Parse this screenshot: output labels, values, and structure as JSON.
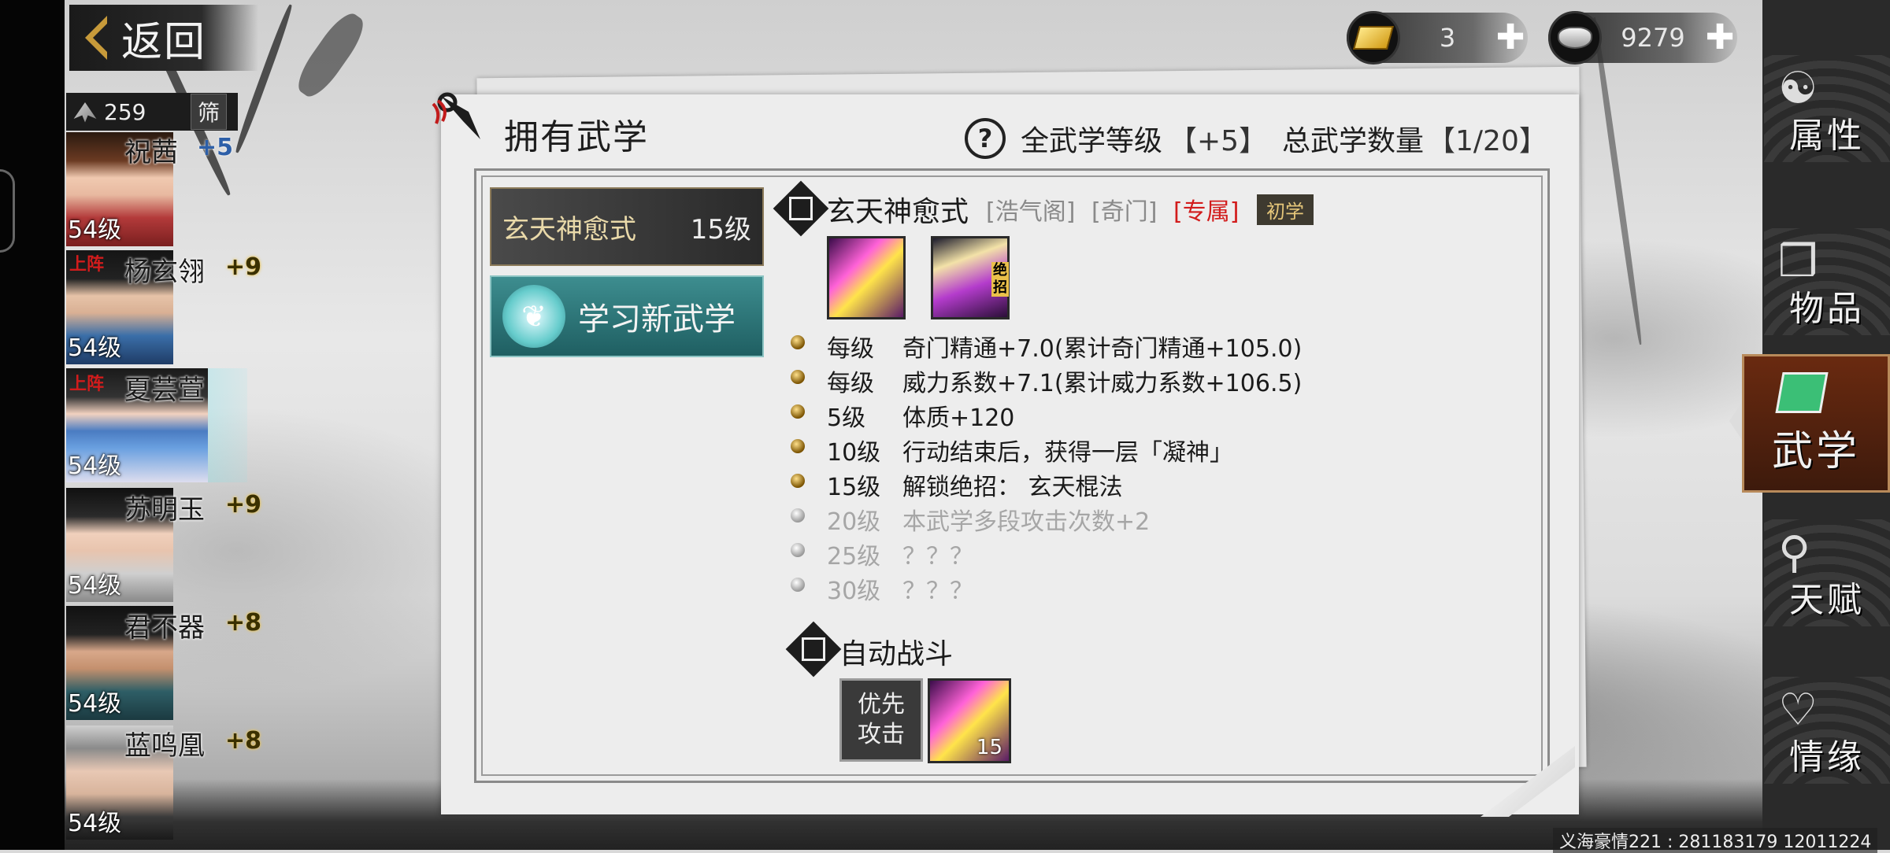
{
  "back": {
    "label": "返回"
  },
  "currency": {
    "gold": {
      "value": "3",
      "icon": "gold-ingot-icon"
    },
    "silver": {
      "value": "9279",
      "icon": "silver-ingot-icon"
    }
  },
  "roster": {
    "count": "259",
    "filter_label": "筛",
    "characters": [
      {
        "name": "祝茜",
        "level": "54级",
        "bonus": "+5",
        "onstage": ""
      },
      {
        "name": "杨玄翎",
        "level": "54级",
        "bonus": "+9",
        "onstage": "上阵"
      },
      {
        "name": "夏芸萱",
        "level": "54级",
        "bonus": "",
        "onstage": "上阵"
      },
      {
        "name": "苏明玉",
        "level": "54级",
        "bonus": "+9",
        "onstage": ""
      },
      {
        "name": "君不器",
        "level": "54级",
        "bonus": "+8",
        "onstage": ""
      },
      {
        "name": "蓝鸣凰",
        "level": "54级",
        "bonus": "+8",
        "onstage": ""
      }
    ]
  },
  "panel": {
    "title": "拥有武学",
    "total_level_label": "全武学等级",
    "total_level_value": "【+5】",
    "total_count_label": "总武学数量",
    "total_count_value": "【1/20】"
  },
  "skill_list": {
    "selected": {
      "name": "玄天神愈式",
      "level": "15级"
    },
    "learn_new": "学习新武学"
  },
  "detail": {
    "name": "玄天神愈式",
    "tags": [
      "[浩气阁]",
      "[奇门]",
      "[专属]"
    ],
    "stage": "初学",
    "ult_mark": "绝招",
    "effects": [
      {
        "level": "每级",
        "text": "奇门精通+7.0(累计奇门精通+105.0)",
        "unlocked": true
      },
      {
        "level": "每级",
        "text": "威力系数+7.1(累计威力系数+106.5)",
        "unlocked": true
      },
      {
        "level": "5级",
        "text": "体质+120",
        "unlocked": true
      },
      {
        "level": "10级",
        "text": "行动结束后，获得一层「凝神」",
        "unlocked": true
      },
      {
        "level": "15级",
        "text": "解锁绝招：  玄天棍法",
        "unlocked": true
      },
      {
        "level": "20级",
        "text": "本武学多段攻击次数+2",
        "unlocked": false
      },
      {
        "level": "25级",
        "text": "？？？",
        "unlocked": false
      },
      {
        "level": "30级",
        "text": "？？？",
        "unlocked": false
      }
    ],
    "auto_battle": {
      "title": "自动战斗",
      "priority_line1": "优先",
      "priority_line2": "攻击",
      "move_count": "15"
    }
  },
  "side_tabs": {
    "attributes": "属性",
    "items": "物品",
    "martial": "武学",
    "talent": "天赋",
    "bond": "情缘"
  },
  "footer": "义海豪情221 : 281183179  12011224"
}
